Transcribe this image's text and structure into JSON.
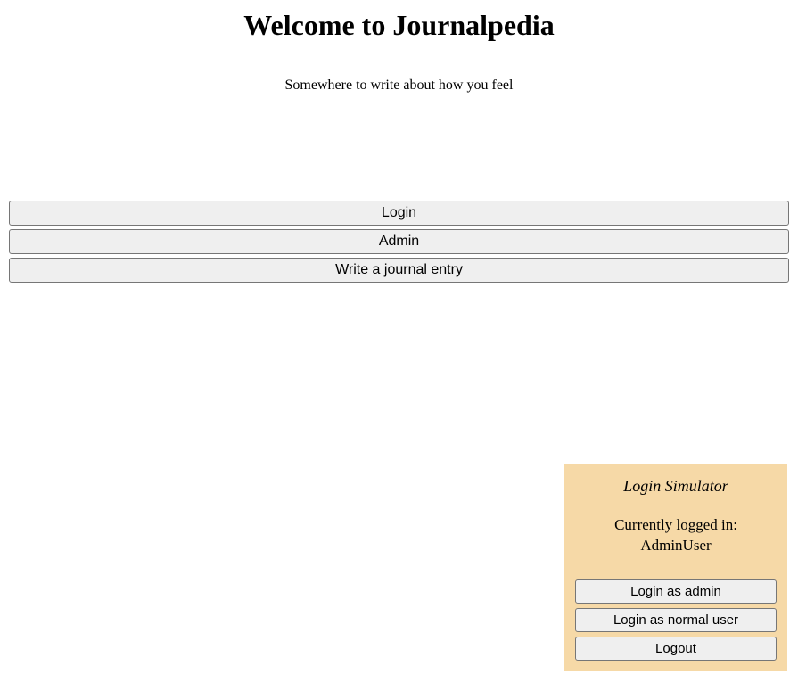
{
  "header": {
    "title": "Welcome to Journalpedia",
    "subtitle": "Somewhere to write about how you feel"
  },
  "main": {
    "login_label": "Login",
    "admin_label": "Admin",
    "write_label": "Write a journal entry"
  },
  "login_simulator": {
    "title": "Login Simulator",
    "status_prefix": "Currently logged in:",
    "current_user": "AdminUser",
    "login_admin_label": "Login as admin",
    "login_normal_label": "Login as normal user",
    "logout_label": "Logout"
  }
}
